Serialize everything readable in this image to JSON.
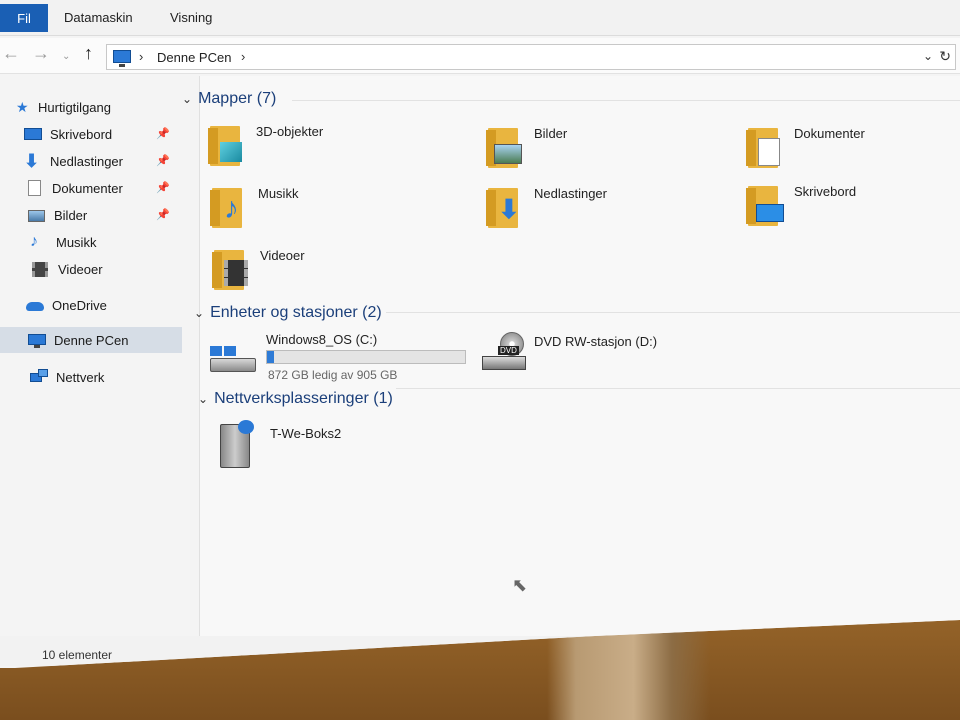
{
  "ribbon": {
    "tabs": [
      "Fil",
      "Datamaskin",
      "Visning"
    ]
  },
  "nav": {
    "back_icon": "back-arrow-icon",
    "forward_icon": "forward-arrow-icon",
    "recent_icon": "chevron-down-icon",
    "up_icon": "up-arrow-icon",
    "address_text": "Denne PCen"
  },
  "sidebar": {
    "items": [
      {
        "label": "Hurtigtilgang",
        "icon": "star-icon"
      },
      {
        "label": "Skrivebord",
        "icon": "desktop-icon",
        "pinned": true
      },
      {
        "label": "Nedlastinger",
        "icon": "download-icon",
        "pinned": true
      },
      {
        "label": "Dokumenter",
        "icon": "document-icon",
        "pinned": true
      },
      {
        "label": "Bilder",
        "icon": "pictures-icon",
        "pinned": true
      },
      {
        "label": "Musikk",
        "icon": "music-icon"
      },
      {
        "label": "Videoer",
        "icon": "video-icon"
      },
      {
        "label": "OneDrive",
        "icon": "cloud-icon"
      },
      {
        "label": "Denne PCen",
        "icon": "computer-icon",
        "selected": true
      },
      {
        "label": "Nettverk",
        "icon": "network-icon"
      }
    ]
  },
  "groups": {
    "folders": {
      "header": "Mapper (7)",
      "items": [
        "3D-objekter",
        "Bilder",
        "Dokumenter",
        "Musikk",
        "Nedlastinger",
        "Skrivebord",
        "Videoer"
      ]
    },
    "devices": {
      "header": "Enheter og stasjoner (2)",
      "items": [
        {
          "name": "Windows8_OS (C:)",
          "info": "872 GB ledig av 905 GB",
          "used_fraction": 0.036
        },
        {
          "name": "DVD RW-stasjon (D:)",
          "badge": "DVD"
        }
      ]
    },
    "network": {
      "header": "Nettverksplasseringer (1)",
      "items": [
        "T-We-Boks2"
      ]
    }
  },
  "status": {
    "count": "10 elementer"
  },
  "colors": {
    "accent": "#1a5fb4",
    "folder": "#e9b53f",
    "group_header": "#1b3f7a"
  }
}
